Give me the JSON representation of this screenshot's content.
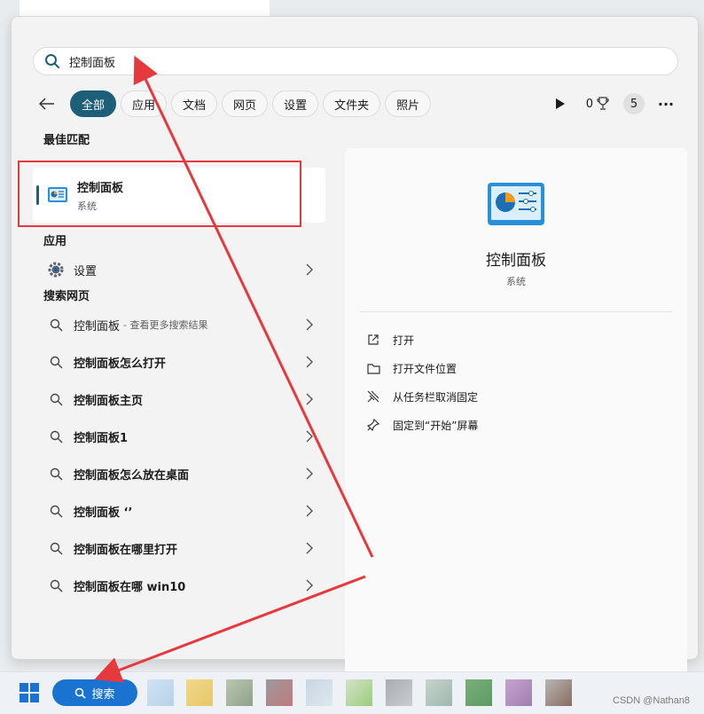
{
  "search": {
    "value": "控制面板"
  },
  "filters": [
    {
      "label": "全部",
      "active": true
    },
    {
      "label": "应用",
      "active": false
    },
    {
      "label": "文档",
      "active": false
    },
    {
      "label": "网页",
      "active": false
    },
    {
      "label": "设置",
      "active": false
    },
    {
      "label": "文件夹",
      "active": false
    },
    {
      "label": "照片",
      "active": false
    }
  ],
  "toolbar": {
    "points": "0",
    "badge": "5",
    "more": "···"
  },
  "best_match": {
    "section": "最佳匹配",
    "title": "控制面板",
    "subtitle": "系统"
  },
  "apps": {
    "section": "应用",
    "items": [
      {
        "label": "设置"
      }
    ]
  },
  "web": {
    "section": "搜索网页",
    "items": [
      {
        "label": "控制面板",
        "hint": "- 查看更多搜索结果"
      },
      {
        "label": "控制面板怎么打开",
        "hint": ""
      },
      {
        "label": "控制面板主页",
        "hint": ""
      },
      {
        "label": "控制面板1",
        "hint": ""
      },
      {
        "label": "控制面板怎么放在桌面",
        "hint": ""
      },
      {
        "label": "控制面板 ‘’",
        "hint": ""
      },
      {
        "label": "控制面板在哪里打开",
        "hint": ""
      },
      {
        "label": "控制面板在哪 win10",
        "hint": ""
      }
    ]
  },
  "preview": {
    "title": "控制面板",
    "subtitle": "系统",
    "actions": [
      {
        "label": "打开",
        "icon": "open-external-icon"
      },
      {
        "label": "打开文件位置",
        "icon": "folder-icon"
      },
      {
        "label": "从任务栏取消固定",
        "icon": "unpin-icon"
      },
      {
        "label": "固定到“开始”屏幕",
        "icon": "pin-icon"
      }
    ]
  },
  "taskbar": {
    "search_label": "搜索",
    "watermark": "CSDN @Nathan8"
  },
  "colors": {
    "accent": "#1d5f78",
    "annotation_red": "#e6393d",
    "taskbar_search": "#1a73d1"
  }
}
